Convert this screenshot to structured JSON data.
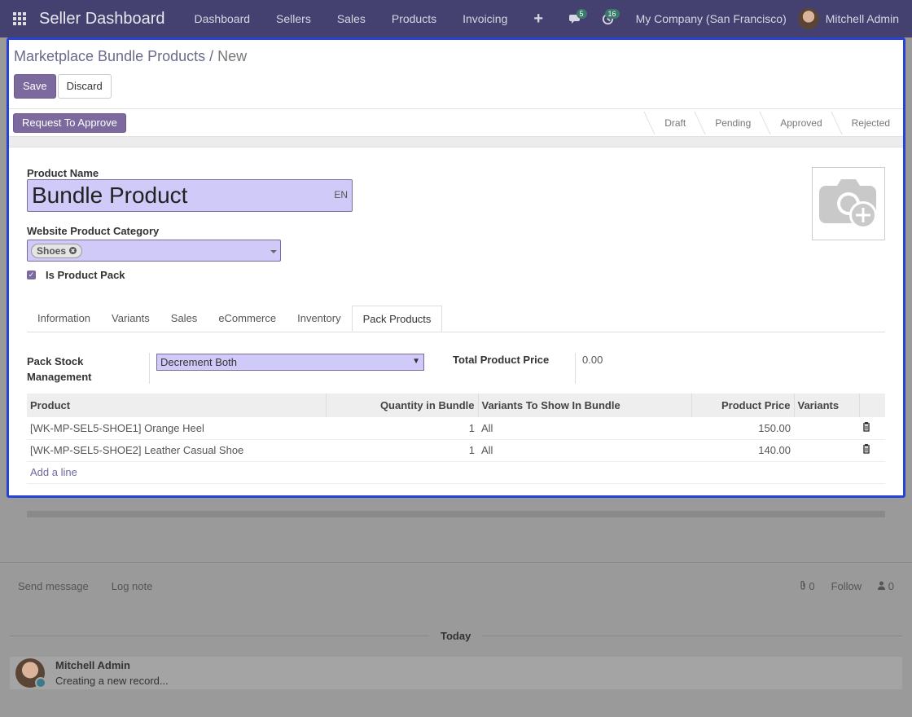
{
  "navbar": {
    "brand": "Seller Dashboard",
    "menu": [
      "Dashboard",
      "Sellers",
      "Sales",
      "Products",
      "Invoicing"
    ],
    "plus_icon": "+",
    "messages_badge": "5",
    "activities_badge": "16",
    "company": "My Company (San Francisco)",
    "user": "Mitchell Admin"
  },
  "breadcrumb": {
    "parent": "Marketplace Bundle Products",
    "separator": "/",
    "current": "New"
  },
  "buttons": {
    "save": "Save",
    "discard": "Discard",
    "request": "Request To Approve"
  },
  "stages": [
    "Draft",
    "Pending",
    "Approved",
    "Rejected"
  ],
  "form": {
    "product_name_label": "Product Name",
    "product_name": "Bundle Product",
    "lang": "EN",
    "category_label": "Website Product Category",
    "category_tag": "Shoes",
    "is_pack_label": "Is Product Pack"
  },
  "tabs": [
    "Information",
    "Variants",
    "Sales",
    "eCommerce",
    "Inventory",
    "Pack Products"
  ],
  "pack": {
    "stock_label": "Pack Stock Management",
    "stock_value": "Decrement Both",
    "total_label": "Total Product Price",
    "total_value": "0.00"
  },
  "table": {
    "headers": [
      "Product",
      "Quantity in Bundle",
      "Variants To Show In Bundle",
      "Product Price",
      "Variants"
    ],
    "rows": [
      {
        "product": "[WK-MP-SEL5-SHOE1] Orange Heel",
        "qty": "1",
        "variants_show": "All",
        "price": "150.00"
      },
      {
        "product": "[WK-MP-SEL5-SHOE2] Leather Casual Shoe",
        "qty": "1",
        "variants_show": "All",
        "price": "140.00"
      }
    ],
    "add_line": "Add a line"
  },
  "chatter": {
    "send_message": "Send message",
    "log_note": "Log note",
    "attachments": "0",
    "follow": "Follow",
    "followers": "0",
    "today": "Today",
    "author": "Mitchell Admin",
    "body": "Creating a new record..."
  }
}
